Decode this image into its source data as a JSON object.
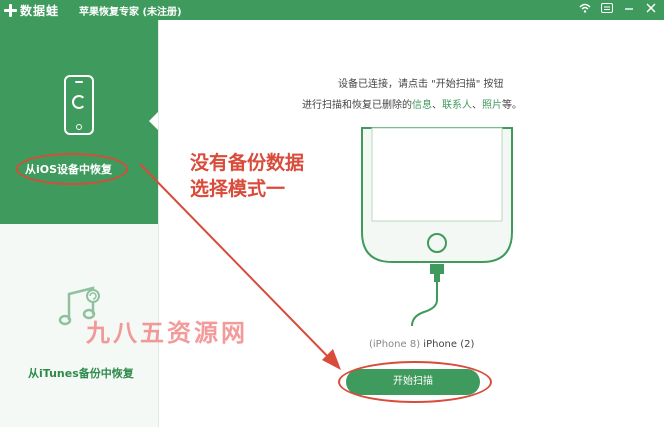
{
  "window": {
    "logo_text": "数据蛙",
    "title": "苹果恢复专家 (未注册)",
    "controls": {
      "wifi": "wifi-icon",
      "menu": "menu-icon",
      "minimize": "minimize-icon",
      "close": "close-icon"
    }
  },
  "sidebar": {
    "items": [
      {
        "label": "从iOS设备中恢复",
        "icon": "phone-refresh-icon",
        "selected": true
      },
      {
        "label": "从iTunes备份中恢复",
        "icon": "music-note-icon",
        "selected": false
      }
    ]
  },
  "main": {
    "line1": "设备已连接，请点击 \"开始扫描\" 按钮",
    "line2_prefix": "进行扫描和恢复已删除的",
    "line2_link1": "信息",
    "sep1": "、",
    "line2_link2": "联系人",
    "sep2": "、",
    "line2_link3": "照片",
    "line2_suffix": "等。",
    "device_model": "(iPhone 8)",
    "device_name": "iPhone (2)",
    "scan_button": "开始扫描"
  },
  "annotation": {
    "line1": "没有备份数据",
    "line2": "选择模式一"
  },
  "watermark": "九八五资源网",
  "colors": {
    "accent": "#3f9a5d",
    "annotation_red": "#d94b3b",
    "sidebar_bg": "#f4f9f5"
  }
}
